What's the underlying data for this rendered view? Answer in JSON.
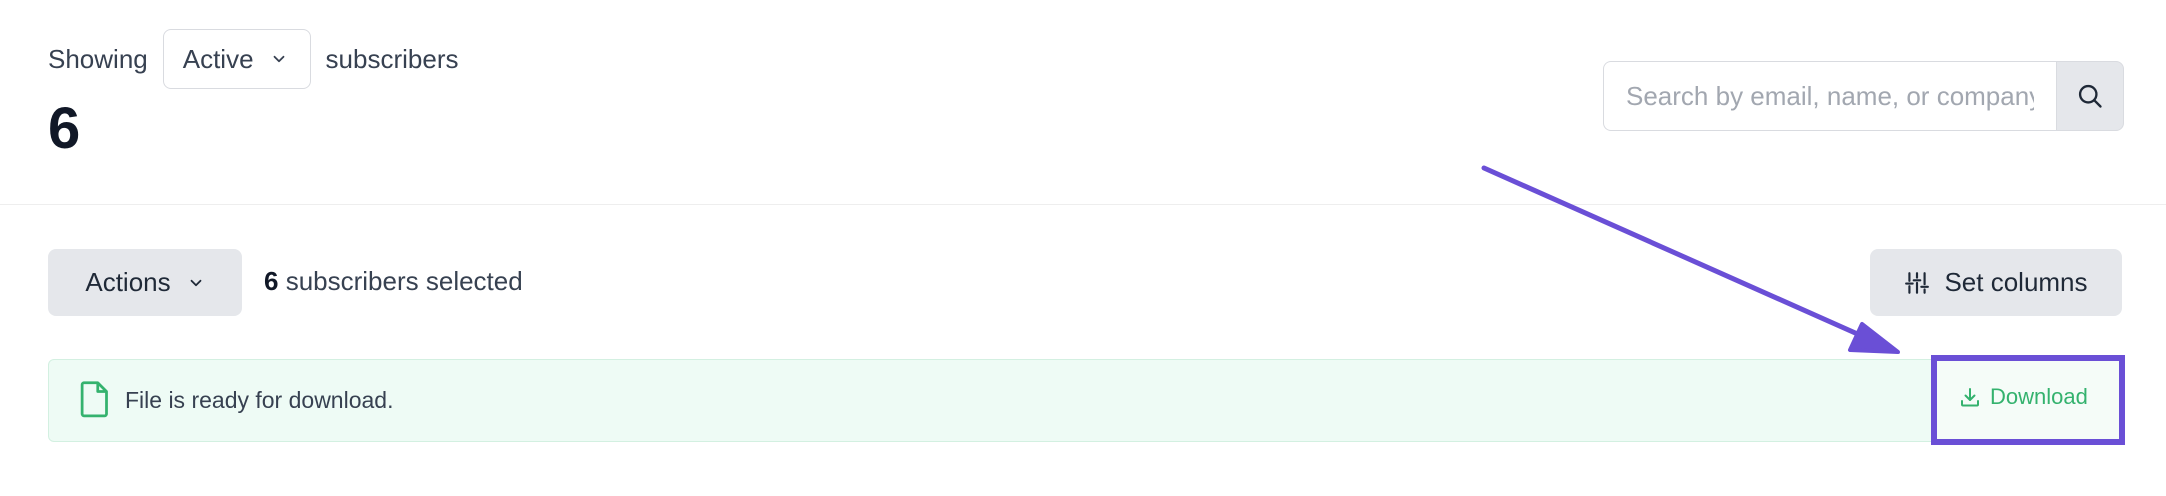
{
  "header": {
    "showing_label": "Showing",
    "status_selected": "Active",
    "subscribers_label": "subscribers",
    "count": "6"
  },
  "search": {
    "placeholder": "Search by email, name, or company"
  },
  "toolbar": {
    "actions_label": "Actions",
    "selected_count": "6",
    "selected_suffix": "subscribers selected",
    "set_columns_label": "Set columns"
  },
  "notice": {
    "message": "File is ready for download.",
    "download_label": "Download"
  },
  "colors": {
    "accent": "#6a4fd6",
    "success": "#34b26e",
    "notice_bg": "#eefbf5"
  },
  "icons": [
    "chevron-down-icon",
    "search-icon",
    "sliders-icon",
    "file-icon",
    "download-icon",
    "arrow-annotation"
  ]
}
